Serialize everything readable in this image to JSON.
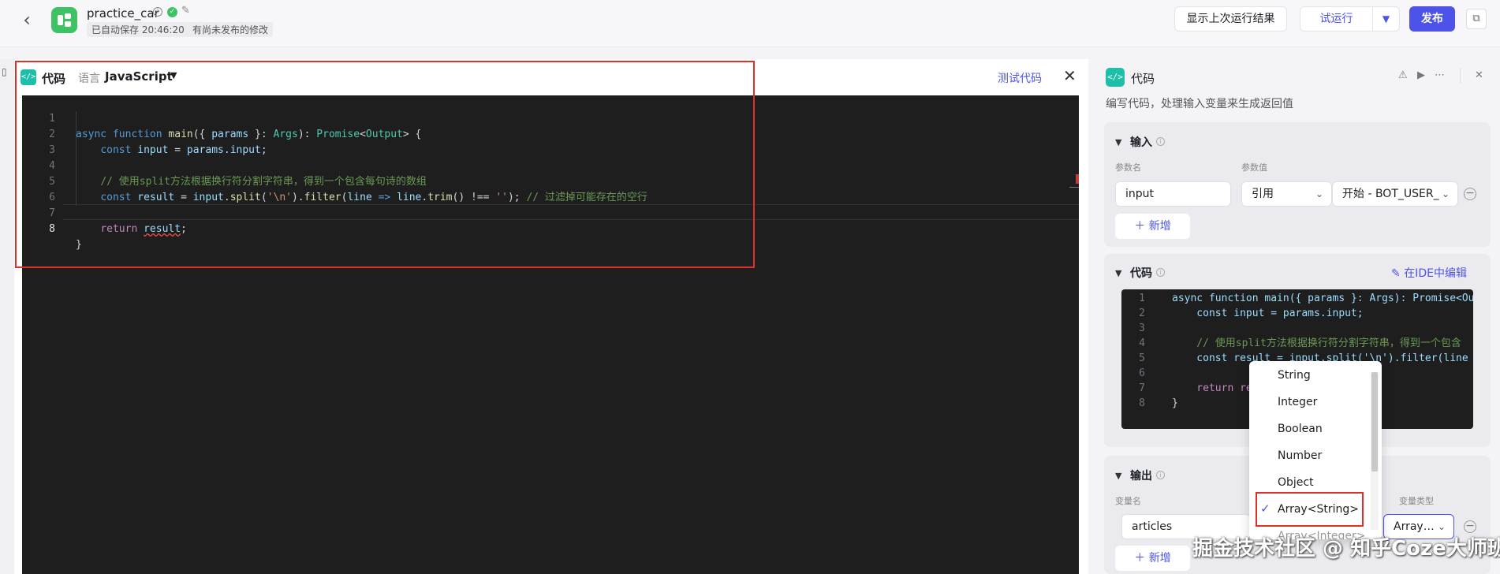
{
  "header": {
    "app_name": "practice_car",
    "auto_save": "已自动保存 20:46:20",
    "unpublished": "有尚未发布的修改",
    "btn_last_result": "显示上次运行结果",
    "btn_test_run": "试运行",
    "btn_publish": "发布"
  },
  "editor": {
    "title": "代码",
    "lang_label": "语言",
    "lang_value": "JavaScript",
    "test_code": "测试代码",
    "lines": [
      {
        "n": "1"
      },
      {
        "n": "2"
      },
      {
        "n": "3"
      },
      {
        "n": "4"
      },
      {
        "n": "5"
      },
      {
        "n": "6"
      },
      {
        "n": "7"
      },
      {
        "n": "8"
      }
    ],
    "code": {
      "l1_kw1": "async",
      "l1_kw2": "function",
      "l1_fn": "main",
      "l1_p1": "({ ",
      "l1_params": "params",
      "l1_p2": " }: ",
      "l1_args": "Args",
      "l1_p3": "): ",
      "l1_promise": "Promise",
      "l1_lt": "<",
      "l1_output": "Output",
      "l1_end": "> {",
      "l2_const": "const",
      "l2_input": "input",
      "l2_eq": " = ",
      "l2_params": "params",
      "l2_dot": ".",
      "l2_input2": "input",
      "l2_semi": ";",
      "l4_comment": "// 使用split方法根据换行符分割字符串，得到一个包含每句诗的数组",
      "l5_const": "const",
      "l5_result": "result",
      "l5_eq": " = ",
      "l5_input": "input",
      "l5_dot1": ".",
      "l5_split": "split",
      "l5_p1": "(",
      "l5_str1": "'\\n'",
      "l5_p2": ").",
      "l5_filter": "filter",
      "l5_p3": "(",
      "l5_line": "line",
      "l5_arrow": " => ",
      "l5_line2": "line",
      "l5_dot2": ".",
      "l5_trim": "trim",
      "l5_p4": "() !== ",
      "l5_str2": "''",
      "l5_p5": "); ",
      "l5_comment": "// 过滤掉可能存在的空行",
      "l7_return": "return",
      "l7_result": "result",
      "l7_semi": ";",
      "l8_brace": "}"
    }
  },
  "side": {
    "title": "代码",
    "description": "编写代码，处理输入变量来生成返回值",
    "input_section": {
      "title": "输入",
      "col_name": "参数名",
      "col_value": "参数值",
      "param_name": "input",
      "ref_type": "引用",
      "ref_value": "开始 - BOT_USER_",
      "add": "新增"
    },
    "code_section": {
      "title": "代码",
      "edit_in_ide": "在IDE中编辑",
      "mini_lines": [
        {
          "n": "1"
        },
        {
          "n": "2"
        },
        {
          "n": "3"
        },
        {
          "n": "4"
        },
        {
          "n": "5"
        },
        {
          "n": "6"
        },
        {
          "n": "7"
        },
        {
          "n": "8"
        }
      ],
      "l1": "async function main({ params }: Args): Promise<Outpu",
      "l2": "    const input = params.input;",
      "l4": "    // 使用split方法根据换行符分割字符串，得到一个包含",
      "l5": "    const result = input.split('\\n').filter(line =",
      "l7": "    return re",
      "l8": "}"
    },
    "output_section": {
      "title": "输出",
      "col_name": "变量名",
      "col_type": "变量类型",
      "var_name": "articles",
      "var_type": "Array…",
      "add": "新增"
    }
  },
  "type_dropdown": {
    "options": [
      "String",
      "Integer",
      "Boolean",
      "Number",
      "Object",
      "Array<String>"
    ],
    "selected": "Array<String>",
    "partial_next": "Array<Integer>"
  },
  "watermark": "掘金技术社区 @ 知乎Coze大师班",
  "colors": {
    "accent": "#4d53e8",
    "highlight_box": "#e0302a",
    "node_icon": "#1dbfa9",
    "logo": "#3ec264"
  }
}
